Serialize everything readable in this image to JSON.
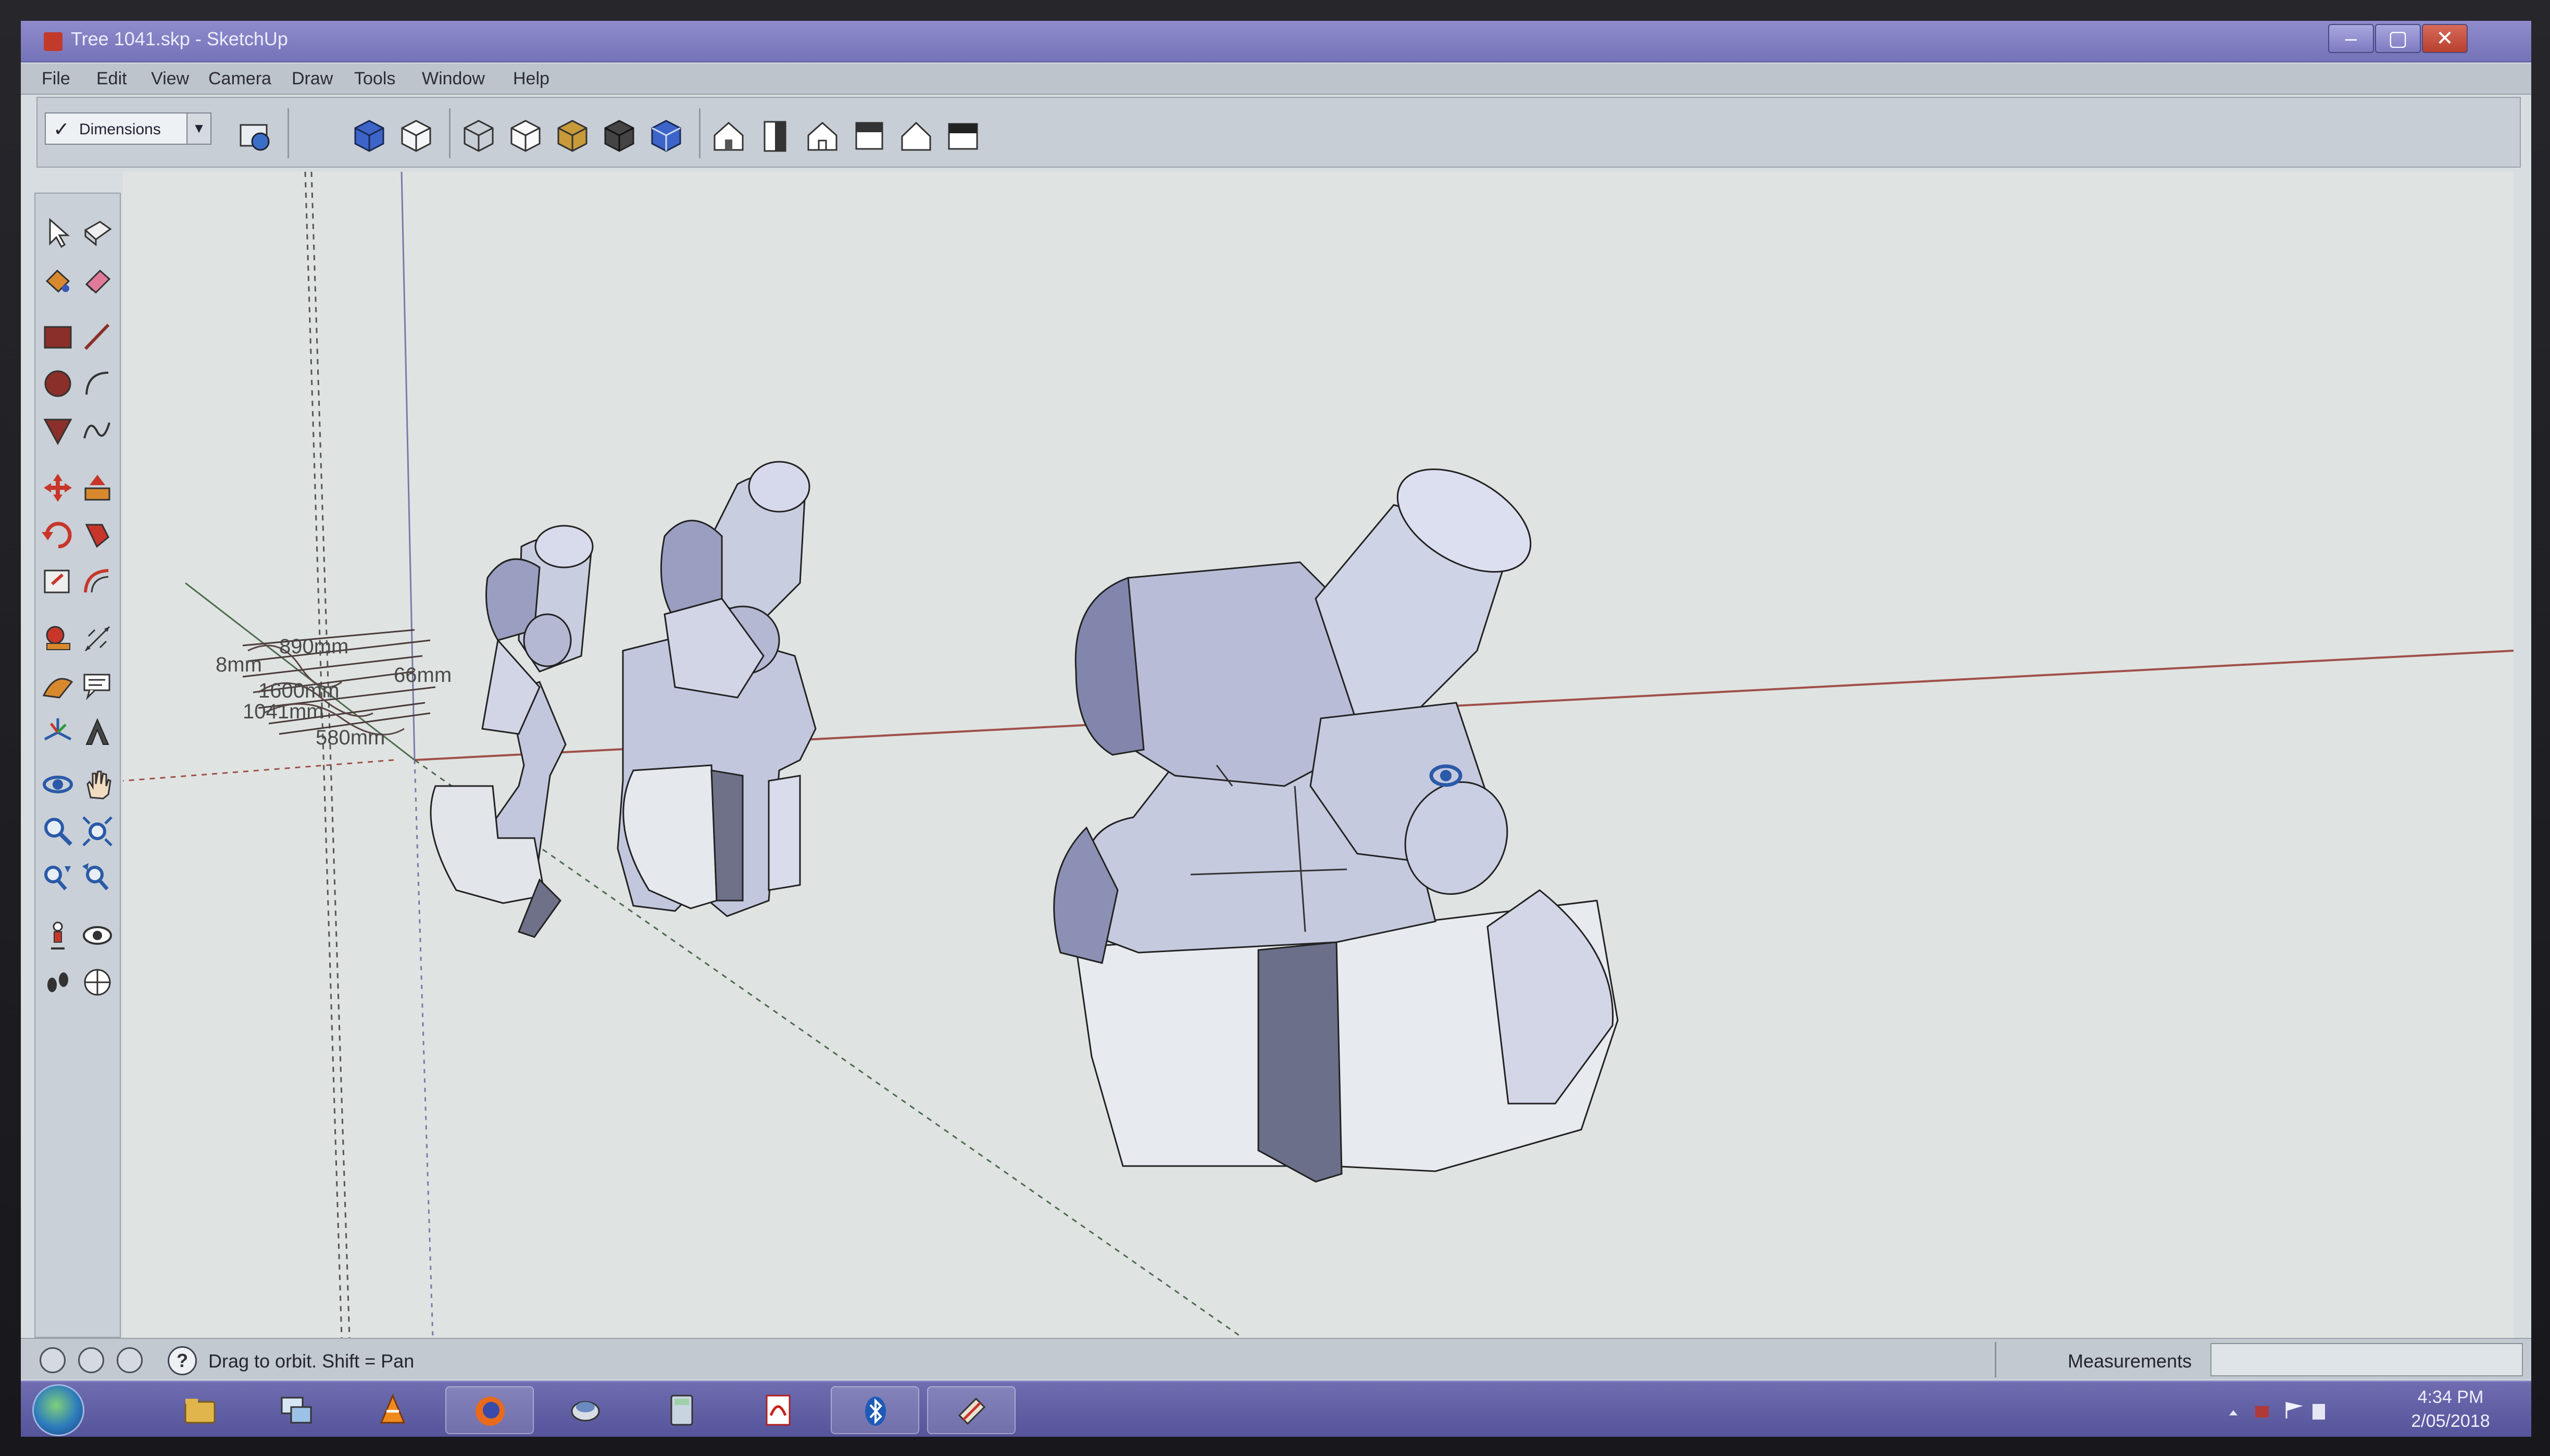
{
  "window": {
    "title": "Tree 1041.skp - SketchUp"
  },
  "menu": [
    "File",
    "Edit",
    "View",
    "Camera",
    "Draw",
    "Tools",
    "Window",
    "Help"
  ],
  "toolbar": {
    "layer_value": "Dimensions",
    "icons": [
      "layer-manager-icon",
      "iso-view-icon",
      "top-view-icon",
      "front-view-icon",
      "right-view-icon",
      "back-view-icon",
      "left-view-icon",
      "xray-icon",
      "wireframe-icon",
      "hidden-line-icon",
      "shaded-icon",
      "shaded-textures-icon",
      "monochrome-icon",
      "house-icon",
      "door-icon",
      "home-icon",
      "save-icon",
      "roof-icon",
      "section-icon"
    ]
  },
  "palette": [
    "select-icon",
    "make-component-icon",
    "paint-bucket-icon",
    "eraser-icon",
    "rectangle-icon",
    "line-icon",
    "circle-icon",
    "arc-icon",
    "polygon-icon",
    "freehand-icon",
    "move-icon",
    "push-pull-icon",
    "rotate-icon",
    "follow-me-icon",
    "scale-icon",
    "offset-icon",
    "tape-measure-icon",
    "dimension-icon",
    "protractor-icon",
    "text-icon",
    "axes-icon",
    "3d-text-icon",
    "orbit-icon",
    "pan-icon",
    "zoom-icon",
    "zoom-window-icon",
    "zoom-extents-icon",
    "previous-view-icon",
    "position-camera-icon",
    "look-around-icon",
    "walk-icon",
    "section-plane-icon"
  ],
  "viewport": {
    "dimension_labels": [
      "890mm",
      "8mm",
      "66mm",
      "1600mm",
      "1041mm",
      "580mm"
    ]
  },
  "status": {
    "text": "Drag to orbit.  Shift = Pan",
    "measurements_label": "Measurements",
    "measurements_value": ""
  },
  "taskbar": {
    "apps": [
      "file-explorer-icon",
      "remote-desktop-icon",
      "vlc-icon",
      "firefox-icon",
      "disk-icon",
      "calculator-icon",
      "pdf-icon",
      "bluetooth-icon",
      "sketchup-icon"
    ],
    "time": "4:34 PM",
    "date": "2/05/2018"
  },
  "colors": {
    "accent": "#7573b8",
    "model_fill": "#b9bdd6",
    "red_axis": "#a0504a"
  }
}
